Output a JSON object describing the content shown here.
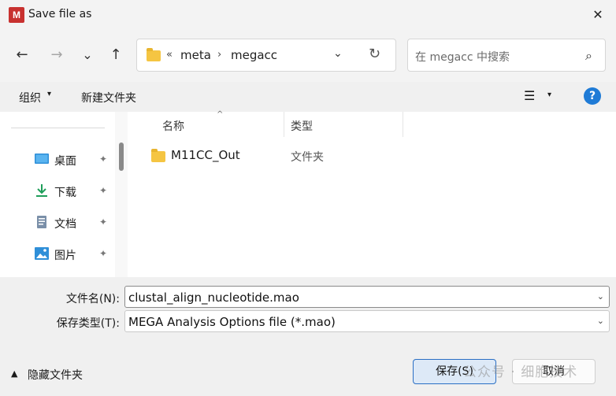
{
  "window": {
    "title": "Save file as",
    "app_icon_text": "M",
    "close_glyph": "✕"
  },
  "nav": {
    "back_glyph": "←",
    "forward_glyph": "→",
    "recent_glyph": "⌄",
    "up_glyph": "↑"
  },
  "address": {
    "overflow": "«",
    "crumbs": [
      "meta",
      "megacc"
    ],
    "separator": "›",
    "dropdown_glyph": "⌄",
    "refresh_glyph": "↻"
  },
  "search": {
    "placeholder": "在 megacc 中搜索",
    "icon_glyph": "⌕"
  },
  "toolbar": {
    "organize": "组织",
    "organize_caret": "▾",
    "new_folder": "新建文件夹",
    "view_glyph": "☰",
    "view_caret": "▾",
    "help": "?"
  },
  "quick_access": [
    {
      "label": "桌面",
      "icon": "desktop-icon"
    },
    {
      "label": "下载",
      "icon": "download-icon"
    },
    {
      "label": "文档",
      "icon": "document-icon"
    },
    {
      "label": "图片",
      "icon": "pictures-icon"
    }
  ],
  "pin_glyph": "✦",
  "columns": {
    "name": "名称",
    "type": "类型",
    "sort_caret": "^"
  },
  "files": [
    {
      "name": "M11CC_Out",
      "type": "文件夹"
    }
  ],
  "fields": {
    "filename_label": "文件名(N):",
    "filename_value": "clustal_align_nucleotide.mao",
    "filetype_label": "保存类型(T):",
    "filetype_value": "MEGA Analysis Options file (*.mao)",
    "caret": "⌄"
  },
  "footer": {
    "hide_folders": "隐藏文件夹",
    "hide_caret": "▲",
    "save": "保存(S)",
    "cancel": "取消",
    "watermark": "公众号 · 细胞技术"
  },
  "colors": {
    "accent": "#2a6fc4",
    "folder": "#f5c542",
    "help": "#1f7bd6",
    "app_icon": "#c8312f"
  }
}
